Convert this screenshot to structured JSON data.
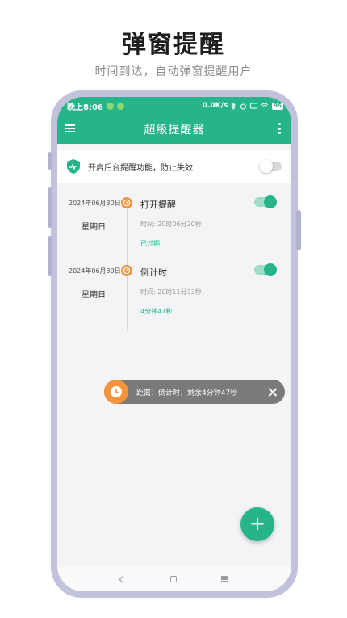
{
  "promo": {
    "title": "弹窗提醒",
    "subtitle": "时间到达，自动弹窗提醒用户"
  },
  "status_bar": {
    "time": "晚上8:06",
    "speed": "0.0K/s",
    "battery": "95"
  },
  "app_bar": {
    "title": "超级提醒器",
    "menu_icon": "menu-icon",
    "more_icon": "more-vert-icon"
  },
  "banner": {
    "text": "开启后台提醒功能，防止失效",
    "toggle_on": false
  },
  "reminders": [
    {
      "date": "2024年06月30日",
      "weekday": "星期日",
      "name": "打开提醒",
      "time": "时间:    20时06分20秒",
      "status": "已过期",
      "enabled": true
    },
    {
      "date": "2024年06月30日",
      "weekday": "星期日",
      "name": "倒计时",
      "time": "时间:    20时11分33秒",
      "status": "4分钟47秒",
      "enabled": true
    }
  ],
  "toast": {
    "text": "距离：倒计时，剩余4分钟47秒"
  },
  "fab": {
    "label": "+"
  },
  "colors": {
    "brand": "#26b48a",
    "accent_orange": "#f5943c",
    "toast_bg": "#7a7a7a"
  }
}
